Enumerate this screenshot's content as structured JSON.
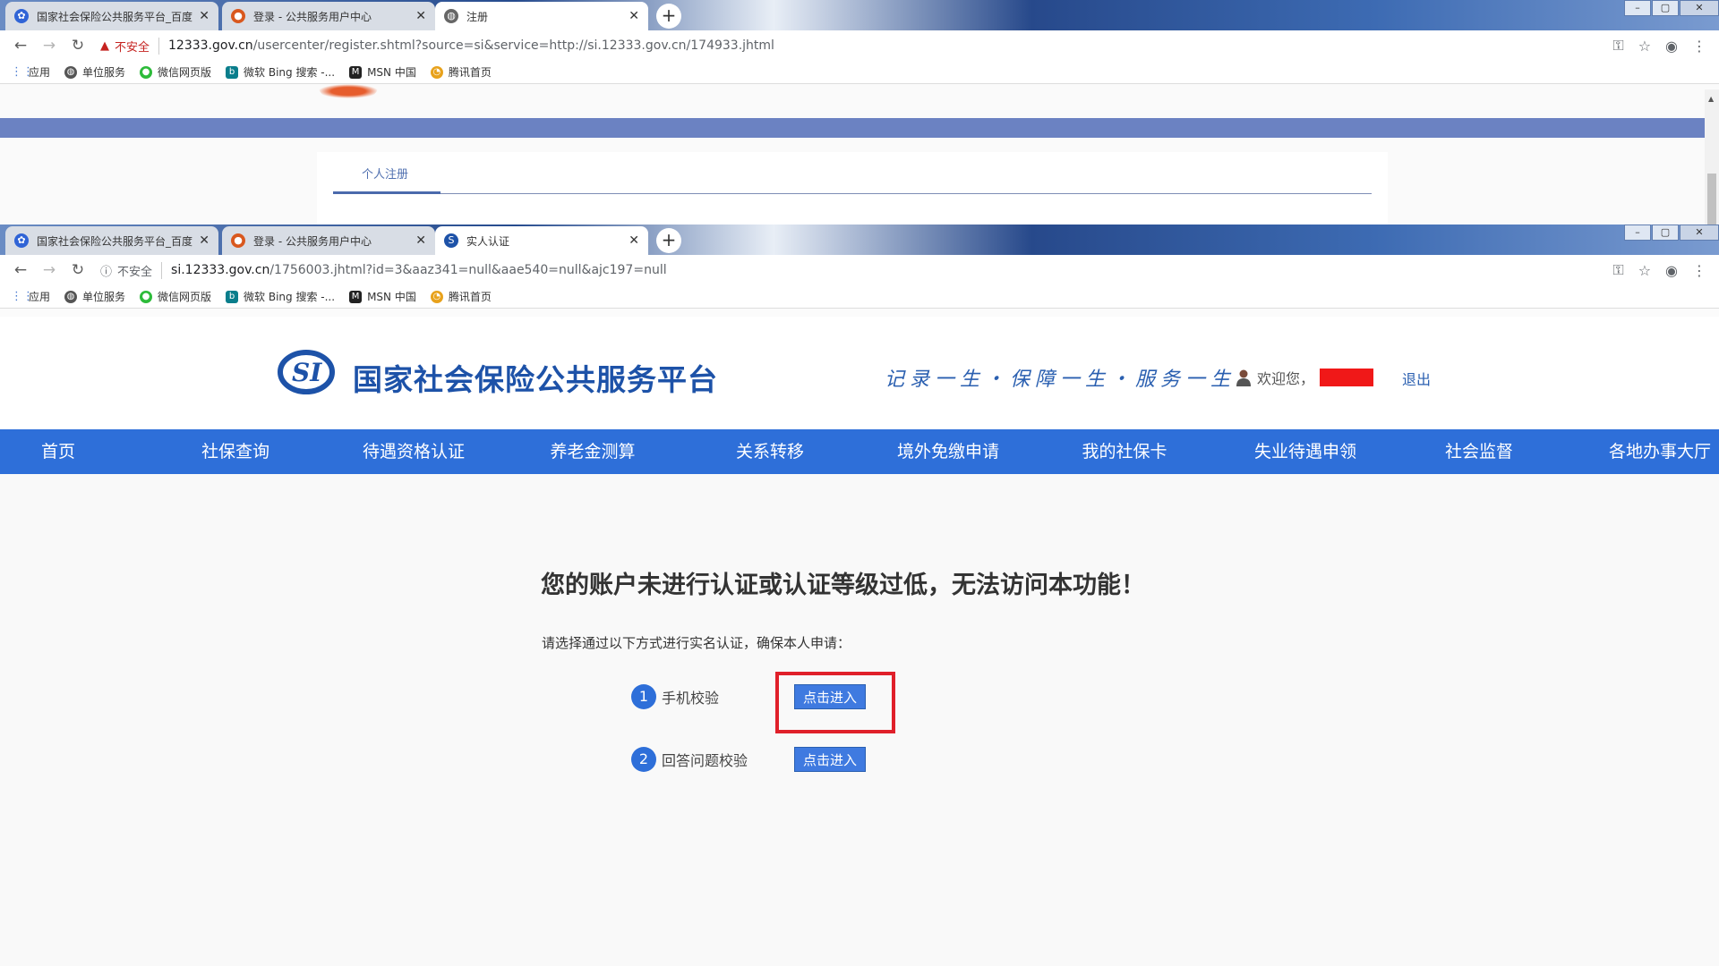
{
  "window1": {
    "tabs": [
      {
        "title": "国家社会保险公共服务平台_百度",
        "favicon": "baidu-paw-icon",
        "active": false
      },
      {
        "title": "登录 - 公共服务用户中心",
        "favicon": "emblem-icon",
        "active": false
      },
      {
        "title": "注册",
        "favicon": "globe-icon",
        "active": true
      }
    ],
    "security_label": "不安全",
    "url_host": "12333.gov.cn",
    "url_path": "/usercenter/register.shtml?source=si&service=http://si.12333.gov.cn/174933.jhtml",
    "register_tab": "个人注册"
  },
  "window2": {
    "tabs": [
      {
        "title": "国家社会保险公共服务平台_百度",
        "favicon": "baidu-paw-icon",
        "active": false
      },
      {
        "title": "登录 - 公共服务用户中心",
        "favicon": "emblem-icon",
        "active": false
      },
      {
        "title": "实人认证",
        "favicon": "si-logo-icon",
        "active": true
      }
    ],
    "security_label": "不安全",
    "url_host": "si.12333.gov.cn",
    "url_path": "/1756003.jhtml?id=3&aaz341=null&aae540=null&ajc197=null"
  },
  "bookmarks": [
    {
      "label": "应用",
      "icon": "apps-grid-icon"
    },
    {
      "label": "单位服务",
      "icon": "globe-icon"
    },
    {
      "label": "微信网页版",
      "icon": "wechat-icon"
    },
    {
      "label": "微软 Bing 搜索 -...",
      "icon": "bing-icon"
    },
    {
      "label": "MSN 中国",
      "icon": "msn-icon"
    },
    {
      "label": "腾讯首页",
      "icon": "tencent-icon"
    }
  ],
  "site": {
    "title": "国家社会保险公共服务平台",
    "slogan": "记录一生・保障一生・服务一生",
    "welcome": "欢迎您，",
    "logout": "退出"
  },
  "nav": [
    "首页",
    "社保查询",
    "待遇资格认证",
    "养老金测算",
    "关系转移",
    "境外免缴申请",
    "我的社保卡",
    "失业待遇申领",
    "社会监督",
    "各地办事大厅"
  ],
  "main": {
    "notice": "您的账户未进行认证或认证等级过低，无法访问本功能！",
    "instruction": "请选择通过以下方式进行实名认证，确保本人申请：",
    "options": [
      {
        "num": "1",
        "label": "手机校验",
        "button": "点击进入"
      },
      {
        "num": "2",
        "label": "回答问题校验",
        "button": "点击进入"
      }
    ]
  },
  "colors": {
    "nav_bg": "#2e6fd9",
    "title_blue": "#1d52a8",
    "highlight_red": "#e0202a",
    "redaction": "#f01818"
  }
}
